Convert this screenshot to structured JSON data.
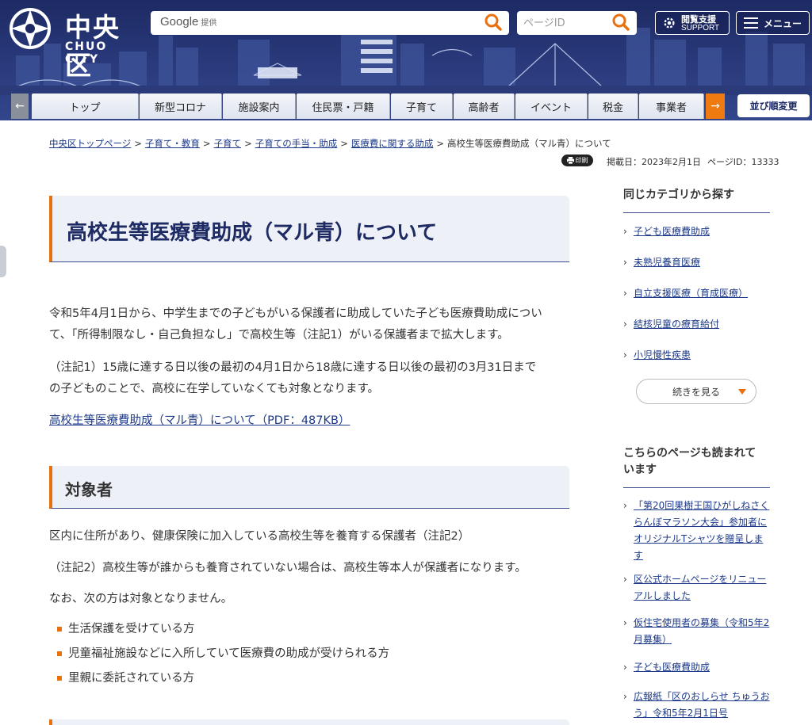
{
  "header": {
    "logo_jp": "中央区",
    "logo_en": "CHUO CITY",
    "search_google": "Google",
    "search_google_suffix": "提供",
    "pageid_placeholder": "ページID",
    "support_label_jp": "閲覧支援",
    "support_label_en": "SUPPORT",
    "menu_label": "メニュー"
  },
  "nav": {
    "prev_glyph": "←",
    "next_glyph": "→",
    "tabs": [
      "トップ",
      "新型コロナ",
      "施設案内",
      "住民票・戸籍",
      "子育て",
      "高齢者",
      "イベント",
      "税金",
      "事業者"
    ],
    "sort_label": "並び順変更"
  },
  "breadcrumb": {
    "links": [
      "中央区トップページ",
      "子育て・教育",
      "子育て",
      "子育ての手当・助成",
      "医療費に関する助成"
    ],
    "current": "高校生等医療費助成（マル青）について",
    "sep": ">"
  },
  "meta": {
    "print_label": "印刷",
    "posted": "掲載日：2023年2月1日",
    "page_id": "ページID：13333"
  },
  "main": {
    "title": "高校生等医療費助成（マル青）について",
    "intro_line1": "令和5年4月1日から、中学生までの子どもがいる保護者に助成していた子ども医療費助成につい",
    "intro_line2": "て、「所得制限なし・自己負担なし」で高校生等（注記1）がいる保護者まで拡大します。",
    "note1_line1": "（注記1）15歳に達する日以後の最初の4月1日から18歳に達する日以後の最初の3月31日まで",
    "note1_line2": "の子どものことで、高校に在学していなくても対象となります。",
    "pdf_link": "高校生等医療費助成（マル青）について（PDF：487KB）",
    "section_title": "対象者",
    "target_text": "区内に住所があり、健康保険に加入している高校生等を養育する保護者（注記2）",
    "note2_text": "（注記2）高校生等が誰からも養育されていない場合は、高校生等本人が保護者になります。",
    "exclusion_intro": "なお、次の方は対象となりません。",
    "exclusions": [
      "生活保護を受けている方",
      "児童福祉施設などに入所していて医療費の助成が受けられる方",
      "里親に委託されている方"
    ]
  },
  "side": {
    "category_title": "同じカテゴリから探す",
    "category_links": [
      "子ども医療費助成",
      "未熟児養育医療",
      "自立支援医療（育成医療）",
      "結核児童の療育給付",
      "小児慢性疾患"
    ],
    "more_label": "続きを見る",
    "popular_title_line1": "こちらのページも読まれて",
    "popular_title_line2": "います",
    "popular_links": [
      [
        "「第20回果樹王国ひがしねさく",
        "らんぼマラソン大会」参加者に",
        "オリジナルTシャツを贈呈しま",
        "す"
      ],
      [
        "区公式ホームページをリニュー",
        "アルしました"
      ],
      [
        "仮住宅使用者の募集（令和5年2",
        "月募集）"
      ],
      [
        "子ども医療費助成"
      ],
      [
        "広報紙「区のおしらせ ちゅうお",
        "う」令和5年2月1日号"
      ]
    ]
  },
  "colors": {
    "navy": "#1d2a63",
    "accent_orange": "#e8700f",
    "link_blue": "#1d3a8a",
    "heading_bg": "#eef0f7"
  }
}
